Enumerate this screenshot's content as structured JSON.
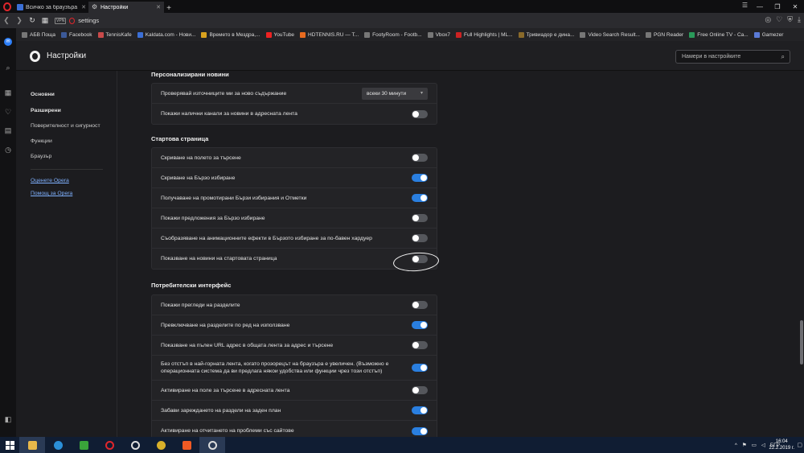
{
  "browser": {
    "tabs": [
      {
        "title": "Всичко за браузъра Opera",
        "active": false
      },
      {
        "title": "Настройки",
        "active": true
      }
    ],
    "address": "settings",
    "vpn_label": "VPN"
  },
  "bookmarks": [
    "АБВ Поща",
    "Facebook",
    "TennisKafe",
    "Kaldata.com - Нови...",
    "Времето в Мездра,...",
    "YouTube",
    "HDTENNIS.RU — T...",
    "FootyRoom - Footb...",
    "Vbox7",
    "Full Highlights | ML...",
    "Тривиадор е дина...",
    "Video Search Result...",
    "PGN Reader",
    "Free Online TV - Ca...",
    "Gamezer"
  ],
  "settings": {
    "title": "Настройки",
    "search_placeholder": "Намери в настройките"
  },
  "nav": {
    "basic": "Основни",
    "advanced": "Разширени",
    "privacy": "Поверителност и сигурност",
    "features": "Функции",
    "browser": "Браузър",
    "rate": "Оценете Opera",
    "help": "Помощ за Opera"
  },
  "sections": {
    "news": {
      "title": "Персонализирани новини",
      "rows": [
        {
          "label": "Проверявай източниците ми за ново съдържание",
          "select": "всеки 30 минути"
        },
        {
          "label": "Покажи налични канали за новини в адресната лента",
          "on": false
        }
      ]
    },
    "start": {
      "title": "Стартова страница",
      "rows": [
        {
          "label": "Скриване на полето за търсене",
          "on": false
        },
        {
          "label": "Скриване на Бързо избиране",
          "on": true
        },
        {
          "label": "Получаване на промотирани Бързи избирания и Отметки",
          "on": true
        },
        {
          "label": "Покажи предложения за Бързо избиране",
          "on": false
        },
        {
          "label": "Съобразяване на анимационните ефекти в Бързото избиране за по-бавен хардуер",
          "on": false
        },
        {
          "label": "Показване на новини на стартовата страница",
          "on": false
        }
      ]
    },
    "ui": {
      "title": "Потребителски интерфейс",
      "rows": [
        {
          "label": "Покажи прегледи на разделите",
          "on": false
        },
        {
          "label": "Превключване на разделите по ред на използване",
          "on": true
        },
        {
          "label": "Показване на пълен URL адрес в общата лента за адрес и търсене",
          "on": false
        },
        {
          "label": "Без отстъп в най-горната лента, когато прозорецът на браузъра е увеличен. (Възможно е операционната система да ви предлага някои удобства или функции чрез този отстъп)",
          "on": true
        },
        {
          "label": "Активиране на поле за търсене в адресната лента",
          "on": false
        },
        {
          "label": "Забави зареждането на раздели на заден план",
          "on": true
        },
        {
          "label": "Активиране на отчитането на проблеми със сайтове",
          "on": true
        }
      ]
    }
  },
  "taskbar": {
    "lang": "БГР",
    "time": "16:04",
    "date": "22.2.2019 г."
  },
  "colors": {
    "accent": "#2a7fe0",
    "opera_red": "#e0262c",
    "taskbar": "#101d33"
  }
}
